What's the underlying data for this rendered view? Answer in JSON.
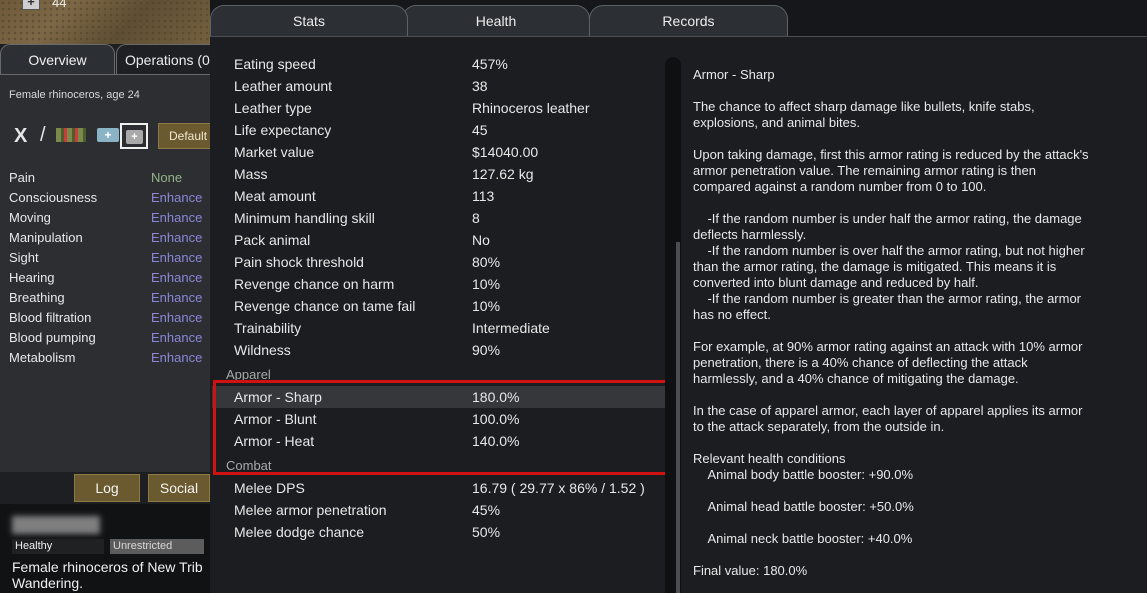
{
  "map": {
    "pawn_count": "44"
  },
  "left_pane": {
    "tabs": [
      "Overview",
      "Operations (0"
    ],
    "description": "Female rhinoceros, age 24",
    "default_button": "Default",
    "capacities": [
      {
        "name": "Pain",
        "value": "None"
      },
      {
        "name": "Consciousness",
        "value": "Enhance"
      },
      {
        "name": "Moving",
        "value": "Enhance"
      },
      {
        "name": "Manipulation",
        "value": "Enhance"
      },
      {
        "name": "Sight",
        "value": "Enhance"
      },
      {
        "name": "Hearing",
        "value": "Enhance"
      },
      {
        "name": "Breathing",
        "value": "Enhance"
      },
      {
        "name": "Blood filtration",
        "value": "Enhance"
      },
      {
        "name": "Blood pumping",
        "value": "Enhance"
      },
      {
        "name": "Metabolism",
        "value": "Enhance"
      }
    ],
    "log_button": "Log",
    "social_button": "Social",
    "status": [
      "Healthy",
      "Unrestricted"
    ],
    "card_line1": "Female rhinoceros of New Trib",
    "card_line2": "Wandering."
  },
  "main_tabs": [
    "Stats",
    "Health",
    "Records"
  ],
  "stats": {
    "rows_top": [
      {
        "name": "Eating speed",
        "value": "457%"
      },
      {
        "name": "Leather amount",
        "value": "38"
      },
      {
        "name": "Leather type",
        "value": "Rhinoceros leather"
      },
      {
        "name": "Life expectancy",
        "value": "45"
      },
      {
        "name": "Market value",
        "value": "$14040.00"
      },
      {
        "name": "Mass",
        "value": "127.62 kg"
      },
      {
        "name": "Meat amount",
        "value": "113"
      },
      {
        "name": "Minimum handling skill",
        "value": "8"
      },
      {
        "name": "Pack animal",
        "value": "No"
      },
      {
        "name": "Pain shock threshold",
        "value": "80%"
      },
      {
        "name": "Revenge chance on harm",
        "value": "10%"
      },
      {
        "name": "Revenge chance on tame fail",
        "value": "10%"
      },
      {
        "name": "Trainability",
        "value": "Intermediate"
      },
      {
        "name": "Wildness",
        "value": "90%"
      }
    ],
    "apparel_label": "Apparel",
    "apparel_rows": [
      {
        "name": "Armor - Sharp",
        "value": "180.0%"
      },
      {
        "name": "Armor - Blunt",
        "value": "100.0%"
      },
      {
        "name": "Armor - Heat",
        "value": "140.0%"
      }
    ],
    "combat_label": "Combat",
    "combat_rows": [
      {
        "name": "Melee DPS",
        "value": "16.79 ( 29.77 x 86% / 1.52 )"
      },
      {
        "name": "Melee armor penetration",
        "value": "45%"
      },
      {
        "name": "Melee dodge chance",
        "value": "50%"
      }
    ]
  },
  "info": {
    "title": "Armor - Sharp",
    "p1": "The chance to affect sharp damage like bullets, knife stabs,\nexplosions, and animal bites.",
    "p2": "Upon taking damage, first this armor rating is reduced by the attack's\narmor penetration value. The remaining armor rating is then\ncompared against a random number from 0 to 100.",
    "p3": "    -If the random number is under half the armor rating, the damage\ndeflects harmlessly.\n    -If the random number is over half the armor rating, but not higher\nthan the armor rating, the damage is mitigated. This means it is\nconverted into blunt damage and reduced by half.\n    -If the random number is greater than the armor rating, the armor\nhas no effect.",
    "p4": "For example, at 90% armor rating against an attack with 10% armor\npenetration, there is a 40% chance of deflecting the attack\nharmlessly, and a 40% chance of mitigating the damage.",
    "p5": "In the case of apparel armor, each layer of apparel applies its armor\nto the attack separately, from the outside in.",
    "conditions_label": "Relevant health conditions",
    "conditions": [
      "    Animal body battle booster: +90.0%",
      "    Animal head battle booster: +50.0%",
      "    Animal neck battle booster: +40.0%"
    ],
    "final": "Final value: 180.0%"
  }
}
